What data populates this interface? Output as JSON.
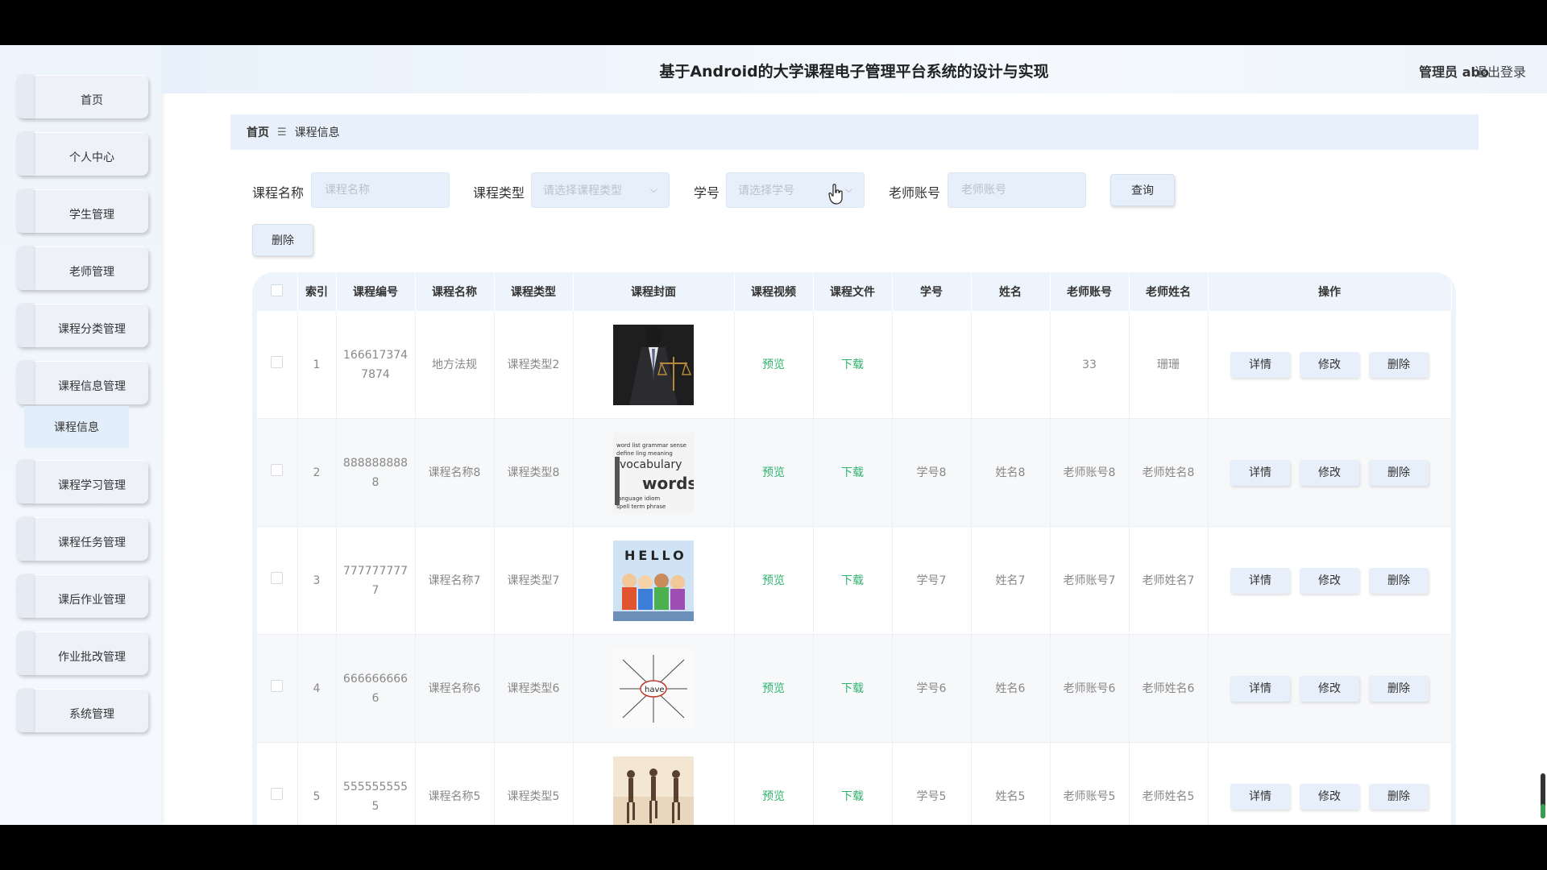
{
  "header": {
    "title": "基于Android的大学课程电子管理平台系统的设计与实现",
    "user": "管理员 abo",
    "logout": "退出登录"
  },
  "sidebar": {
    "items": [
      {
        "label": "首页"
      },
      {
        "label": "个人中心"
      },
      {
        "label": "学生管理"
      },
      {
        "label": "老师管理"
      },
      {
        "label": "课程分类管理"
      },
      {
        "label": "课程信息管理"
      },
      {
        "label": "课程学习管理"
      },
      {
        "label": "课程任务管理"
      },
      {
        "label": "课后作业管理"
      },
      {
        "label": "作业批改管理"
      },
      {
        "label": "系统管理"
      }
    ],
    "submenu": {
      "label": "课程信息"
    }
  },
  "breadcrumb": {
    "home": "首页",
    "separator": "☰",
    "current": "课程信息"
  },
  "filters": {
    "course_name": {
      "label": "课程名称",
      "placeholder": "课程名称"
    },
    "course_type": {
      "label": "课程类型",
      "placeholder": "请选择课程类型"
    },
    "student_no": {
      "label": "学号",
      "placeholder": "请选择学号"
    },
    "teacher_account": {
      "label": "老师账号",
      "placeholder": "老师账号"
    },
    "query_button": "查询",
    "delete_button": "删除"
  },
  "table": {
    "columns": [
      "索引",
      "课程编号",
      "课程名称",
      "课程类型",
      "课程封面",
      "课程视频",
      "课程文件",
      "学号",
      "姓名",
      "老师账号",
      "老师姓名",
      "操作"
    ],
    "video_link": "预览",
    "file_link": "下载",
    "actions": {
      "detail": "详情",
      "edit": "修改",
      "delete": "删除"
    },
    "rows": [
      {
        "index": "1",
        "code_line1": "166617374",
        "code_line2": "7874",
        "name": "地方法规",
        "type": "课程类型2",
        "student_no": "",
        "student_name": "",
        "teacher_account": "33",
        "teacher_name": "珊珊",
        "cover_icon": "justice-scale-image"
      },
      {
        "index": "2",
        "code_line1": "888888888",
        "code_line2": "8",
        "name": "课程名称8",
        "type": "课程类型8",
        "student_no": "学号8",
        "student_name": "姓名8",
        "teacher_account": "老师账号8",
        "teacher_name": "老师姓名8",
        "cover_icon": "vocabulary-words-image",
        "cover_text1": "vocabulary",
        "cover_text2": "words"
      },
      {
        "index": "3",
        "code_line1": "777777777",
        "code_line2": "7",
        "name": "课程名称7",
        "type": "课程类型7",
        "student_no": "学号7",
        "student_name": "姓名7",
        "teacher_account": "老师账号7",
        "teacher_name": "老师姓名7",
        "cover_icon": "hello-kids-image",
        "cover_text1": "HELLO"
      },
      {
        "index": "4",
        "code_line1": "666666666",
        "code_line2": "6",
        "name": "课程名称6",
        "type": "课程类型6",
        "student_no": "学号6",
        "student_name": "姓名6",
        "teacher_account": "老师账号6",
        "teacher_name": "老师姓名6",
        "cover_icon": "have-wordmap-image",
        "cover_text1": "have"
      },
      {
        "index": "5",
        "code_line1": "555555555",
        "code_line2": "5",
        "name": "课程名称5",
        "type": "课程类型5",
        "student_no": "学号5",
        "student_name": "姓名5",
        "teacher_account": "老师账号5",
        "teacher_name": "老师姓名5",
        "cover_icon": "runners-image"
      }
    ]
  },
  "colors": {
    "accent": "#e6effa",
    "link": "#2fb46e",
    "header_bg": "#e8f1fb"
  }
}
